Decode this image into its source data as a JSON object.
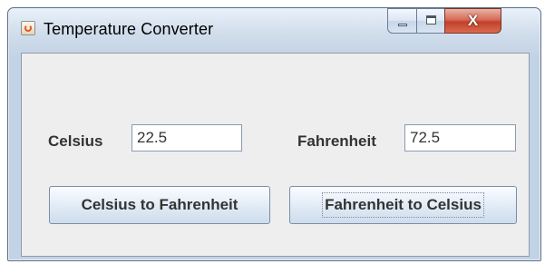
{
  "window": {
    "title": "Temperature Converter",
    "controls": {
      "minimize": "minimize-icon",
      "maximize": "maximize-icon",
      "close": "X"
    }
  },
  "form": {
    "celsius_label": "Celsius",
    "celsius_value": "22.5",
    "fahrenheit_label": "Fahrenheit",
    "fahrenheit_value": "72.5"
  },
  "buttons": {
    "c_to_f": "Celsius to Fahrenheit",
    "f_to_c": "Fahrenheit to Celsius"
  },
  "colors": {
    "frame": "#c3d3e6",
    "panel": "#eeeeee",
    "close": "#c2402a"
  }
}
